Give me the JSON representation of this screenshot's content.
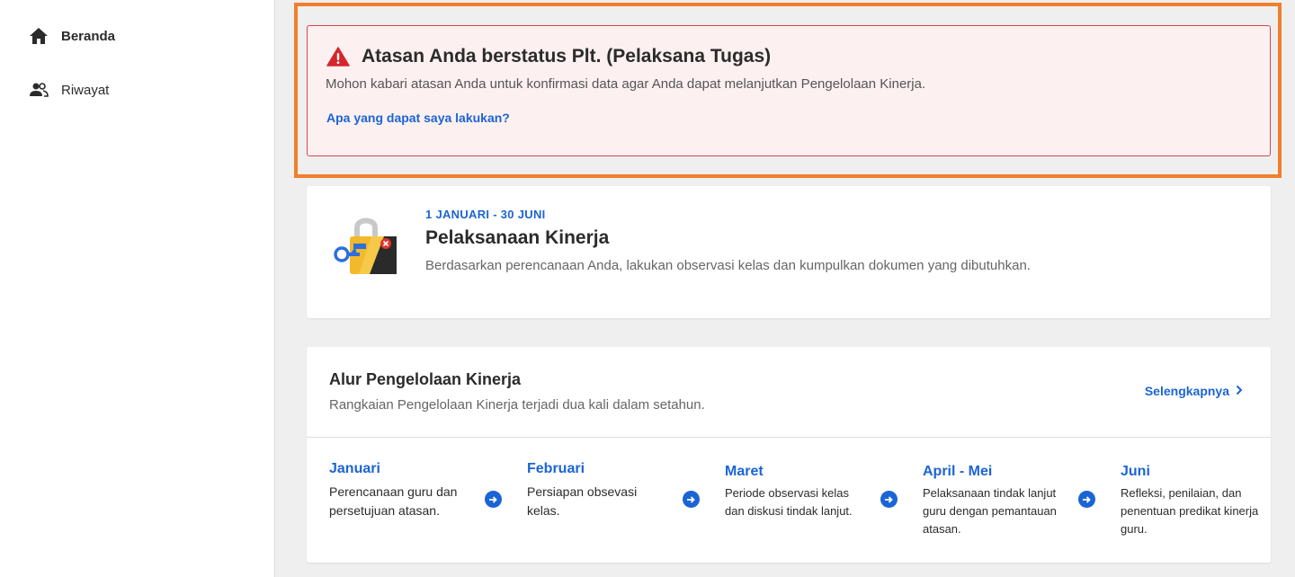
{
  "sidebar": {
    "items": [
      {
        "label": "Beranda",
        "icon": "home-icon",
        "active": true
      },
      {
        "label": "Riwayat",
        "icon": "users-icon",
        "active": false
      }
    ]
  },
  "alert": {
    "title": "Atasan Anda berstatus Plt. (Pelaksana Tugas)",
    "description": "Mohon kabari atasan Anda untuk konfirmasi data agar Anda dapat melanjutkan Pengelolaan Kinerja.",
    "link": "Apa yang dapat saya lakukan?",
    "icon": "warning-icon"
  },
  "performance": {
    "date_range": "1 JANUARI - 30 JUNI",
    "title": "Pelaksanaan Kinerja",
    "description": "Berdasarkan perencanaan Anda, lakukan observasi kelas dan kumpulkan dokumen yang dibutuhkan."
  },
  "flow": {
    "title": "Alur Pengelolaan Kinerja",
    "subtitle": "Rangkaian Pengelolaan Kinerja terjadi dua kali dalam setahun.",
    "more_link": "Selengkapnya",
    "steps": [
      {
        "name": "Januari",
        "desc": "Perencanaan guru dan persetujuan atasan."
      },
      {
        "name": "Februari",
        "desc": "Persiapan obsevasi kelas."
      },
      {
        "name": "Maret",
        "desc": "Periode observasi kelas dan diskusi tindak lanjut."
      },
      {
        "name": "April - Mei",
        "desc": "Pelaksanaan tindak lanjut guru dengan pemantauan atasan."
      },
      {
        "name": "Juni",
        "desc": "Refleksi, penilaian, dan penentuan predikat kinerja guru."
      }
    ]
  },
  "colors": {
    "accent": "#1b64d6",
    "alert_border": "#d6454c",
    "alert_bg": "#fdf0f0",
    "highlight": "#f07f2c"
  }
}
